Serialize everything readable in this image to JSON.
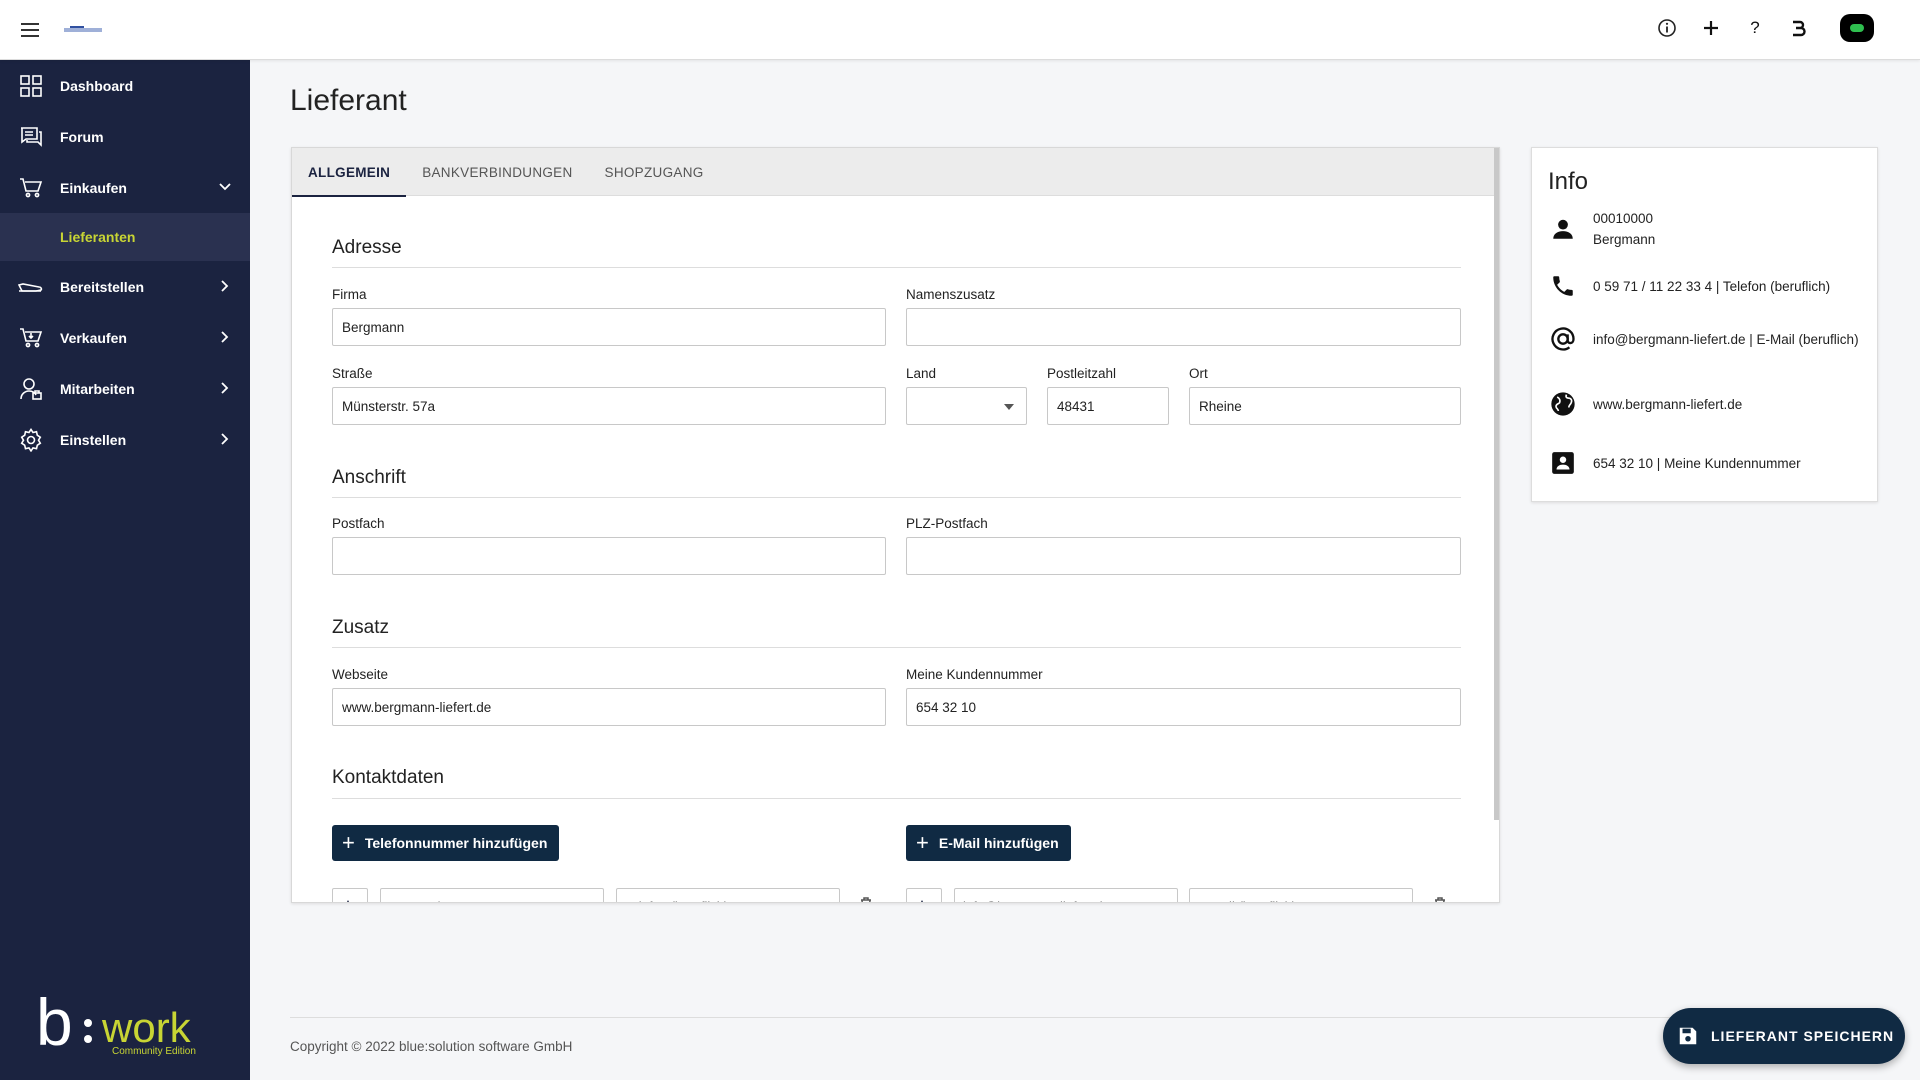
{
  "topbar": {
    "icons": [
      "menu-icon",
      "info-icon",
      "plus-icon",
      "help-icon",
      "b-logo-icon",
      "avatar"
    ]
  },
  "sidebar": {
    "items": [
      {
        "label": "Dashboard",
        "icon": "dashboard-icon"
      },
      {
        "label": "Forum",
        "icon": "forum-icon"
      },
      {
        "label": "Einkaufen",
        "icon": "cart-icon",
        "expanded": true
      },
      {
        "label": "Lieferanten",
        "sub": true,
        "active": true
      },
      {
        "label": "Bereitstellen",
        "icon": "delivery-icon"
      },
      {
        "label": "Verkaufen",
        "icon": "sell-cart-icon"
      },
      {
        "label": "Mitarbeiten",
        "icon": "employee-icon"
      },
      {
        "label": "Einstellen",
        "icon": "settings-icon"
      }
    ],
    "brand": {
      "b": "b",
      "work": "work",
      "edition": "Community Edition",
      "accent": "#c8d534"
    }
  },
  "page": {
    "title": "Lieferant"
  },
  "tabs": [
    "ALLGEMEIN",
    "BANKVERBINDUNGEN",
    "SHOPZUGANG"
  ],
  "form": {
    "adresse": {
      "title": "Adresse",
      "firma_label": "Firma",
      "firma_value": "Bergmann",
      "namenszusatz_label": "Namenszusatz",
      "namenszusatz_value": "",
      "strasse_label": "Straße",
      "strasse_value": "Münsterstr. 57a",
      "land_label": "Land",
      "land_value": "",
      "plz_label": "Postleitzahl",
      "plz_value": "48431",
      "ort_label": "Ort",
      "ort_value": "Rheine"
    },
    "anschrift": {
      "title": "Anschrift",
      "postfach_label": "Postfach",
      "postfach_value": "",
      "plz_postfach_label": "PLZ-Postfach",
      "plz_postfach_value": ""
    },
    "zusatz": {
      "title": "Zusatz",
      "webseite_label": "Webseite",
      "webseite_value": "www.bergmann-liefert.de",
      "kundennummer_label": "Meine Kundennummer",
      "kundennummer_value": "654 32 10"
    },
    "kontakt": {
      "title": "Kontaktdaten",
      "add_phone": "Telefonnummer hinzufügen",
      "add_email": "E-Mail hinzufügen",
      "phone_value": "0 59 71 / 11 22 33 4",
      "phone_type": "Telefon (beruflich)",
      "email_value": "info@bergmann-liefert.de",
      "email_type": "E-Mail (beruflich)"
    }
  },
  "info": {
    "title": "Info",
    "number": "00010000",
    "name": "Bergmann",
    "phone": "0 59 71 / 11 22 33 4 | Telefon (beruflich)",
    "email": "info@bergmann-liefert.de | E-Mail (beruflich)",
    "web": "www.bergmann-liefert.de",
    "customer": "654 32 10 | Meine Kundennummer"
  },
  "footer": {
    "copyright": "Copyright © 2022 blue:solution software GmbH"
  },
  "save_button": "LIEFERANT SPEICHERN"
}
